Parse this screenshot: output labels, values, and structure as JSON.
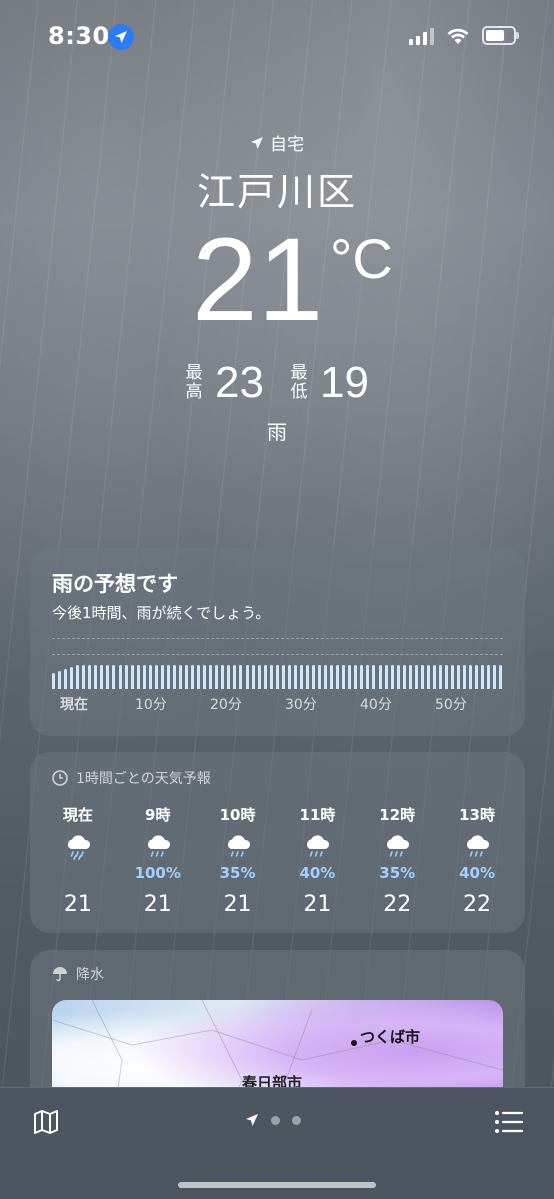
{
  "status_bar": {
    "time": "8:30"
  },
  "hero": {
    "home_label": "自宅",
    "city": "江戸川区",
    "temperature": "21",
    "unit": "°C",
    "high_label": "最高",
    "high": "23",
    "low_label": "最低",
    "low": "19",
    "condition": "雨"
  },
  "rain_card": {
    "title": "雨の予想です",
    "subtitle": "今後1時間、雨が続くでしょう。",
    "axis": [
      "現在",
      "10分",
      "20分",
      "30分",
      "40分",
      "50分"
    ],
    "bar_color": "#cfe6fb"
  },
  "hourly": {
    "header": "1時間ごとの天気予報",
    "items": [
      {
        "time": "現在",
        "pct": "",
        "temp": "21"
      },
      {
        "time": "9時",
        "pct": "100%",
        "temp": "21"
      },
      {
        "time": "10時",
        "pct": "35%",
        "temp": "21"
      },
      {
        "time": "11時",
        "pct": "40%",
        "temp": "21"
      },
      {
        "time": "12時",
        "pct": "35%",
        "temp": "22"
      },
      {
        "time": "13時",
        "pct": "40%",
        "temp": "22"
      }
    ],
    "pct_color": "#9fd2ff"
  },
  "precip": {
    "header": "降水",
    "map_label_1": "つくば市",
    "map_label_2": "春日部市"
  }
}
